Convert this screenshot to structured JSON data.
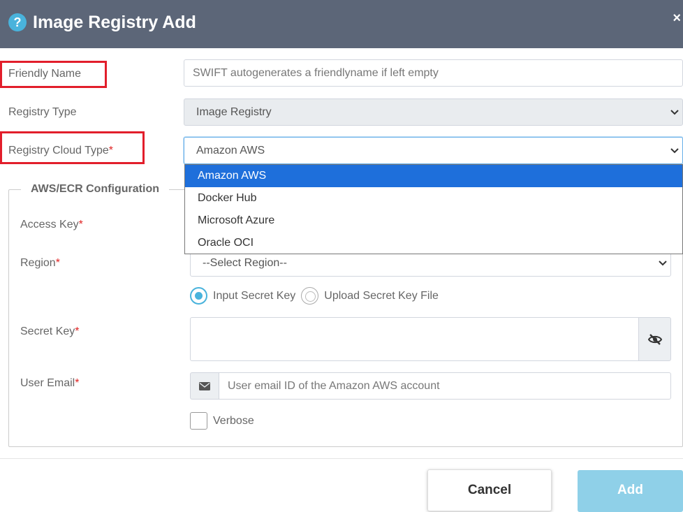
{
  "dialog": {
    "title": "Image Registry Add",
    "help_icon": "?",
    "close_icon": "×"
  },
  "form": {
    "friendly_name": {
      "label": "Friendly Name",
      "placeholder": "SWIFT autogenerates a friendlyname if left empty"
    },
    "registry_type": {
      "label": "Registry Type",
      "value": "Image Registry"
    },
    "registry_cloud_type": {
      "label": "Registry Cloud Type",
      "required": "*",
      "value": "Amazon AWS",
      "options": [
        "Amazon AWS",
        "Docker Hub",
        "Microsoft Azure",
        "Oracle OCI"
      ],
      "selected_index": 0
    }
  },
  "aws": {
    "legend": "AWS/ECR Configuration",
    "access_key": {
      "label": "Access Key",
      "required": "*"
    },
    "region": {
      "label": "Region",
      "required": "*",
      "value": "--Select Region--"
    },
    "secret_mode": {
      "option_input": "Input Secret Key",
      "option_upload": "Upload Secret Key File",
      "selected": "Input Secret Key"
    },
    "secret_key": {
      "label": "Secret Key",
      "required": "*",
      "value": ""
    },
    "user_email": {
      "label": "User Email",
      "required": "*",
      "placeholder": "User email ID of the Amazon AWS account"
    },
    "verbose": {
      "label": "Verbose",
      "checked": false
    }
  },
  "footer": {
    "cancel_label": "Cancel",
    "add_label": "Add"
  },
  "colors": {
    "header_bg": "#5c6678",
    "accent": "#49b3dc",
    "highlight_border": "#e21e2b",
    "selected_option": "#1e6fdb",
    "add_button": "#8fd0e8"
  },
  "icons": {
    "help": "question-circle-icon",
    "close": "close-icon",
    "eye_slash": "eye-slash-icon",
    "envelope": "envelope-icon",
    "chevron": "chevron-down-icon"
  }
}
